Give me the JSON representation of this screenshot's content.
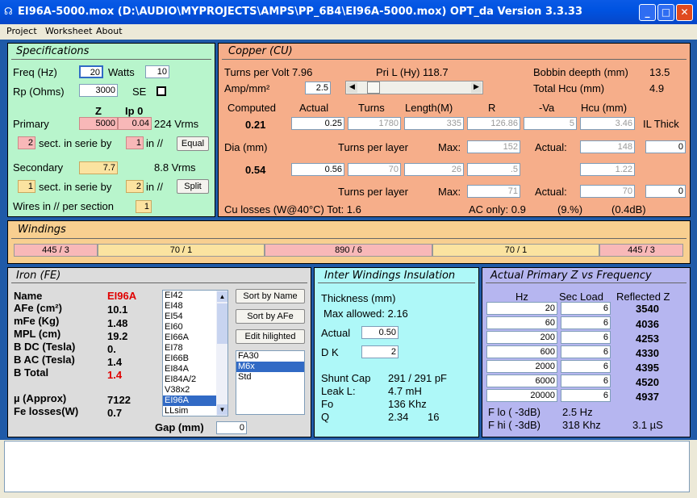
{
  "window": {
    "title": "EI96A-5000.mox  (D:\\AUDIO\\MYPROJECTS\\AMPS\\PP_6B4\\EI96A-5000.mox)  OPT_da Version 3.3.33"
  },
  "menu": [
    "Project",
    "Worksheet",
    "About"
  ],
  "specs": {
    "title": "Specifications",
    "freq_label": "Freq (Hz)",
    "freq": "20",
    "watts_label": "Watts",
    "watts": "10",
    "rp_label": "Rp (Ohms)",
    "rp": "3000",
    "se_label": "SE",
    "z_head": "Z",
    "ip0_head": "Ip 0",
    "primary_label": "Primary",
    "primary_z": "5000",
    "primary_ip0": "0.04",
    "primary_vrms": "224 Vrms",
    "primary_sect": "2",
    "sect_text": "sect. in serie by",
    "primary_par": "1",
    "in_par": "in //",
    "equal_btn": "Equal",
    "secondary_label": "Secondary",
    "secondary_z": "7.7",
    "secondary_vrms": "8.8 Vrms",
    "secondary_sect": "1",
    "secondary_par": "2",
    "split_btn": "Split",
    "wires_label": "Wires in // per section",
    "wires": "1"
  },
  "copper": {
    "title": "Copper (CU)",
    "tpv": "Turns per Volt 7.96",
    "pril": "Pri L (Hy) 118.7",
    "bobbin_label": "Bobbin deepth (mm)",
    "bobbin": "13.5",
    "amp_label": "Amp/mm²",
    "amp": "2.5",
    "hcu_label": "Total Hcu (mm)",
    "hcu": "4.9",
    "h_computed": "Computed",
    "h_actual": "Actual",
    "h_turns": "Turns",
    "h_length": "Length(M)",
    "h_r": "R",
    "h_va": "-Va",
    "h_hcu": "Hcu (mm)",
    "h_il": "IL Thick",
    "computed": "0.21",
    "actual": "0.25",
    "turns": "1780",
    "length": "335",
    "r": "126.86",
    "va": "5",
    "hcu_val": "3.46",
    "dia_label": "Dia (mm)",
    "tpl_label": "Turns per layer",
    "max_label": "Max:",
    "act_label": "Actual:",
    "pri_max": "152",
    "pri_actual": "148",
    "pri_il": "0",
    "dia_computed": "0.54",
    "dia_actual": "0.56",
    "sec_turns": "70",
    "sec_length": "26",
    "sec_r": ".5",
    "sec_hcu": "1.22",
    "sec_max": "71",
    "sec_actual": "70",
    "sec_il": "0",
    "culosses": "Cu losses (W@40°C) Tot: 1.6",
    "aconly": "AC only: 0.9",
    "pct": "(9.%)",
    "db": "(0.4dB)"
  },
  "windings": {
    "title": "Windings",
    "cells": [
      "445 / 3",
      "70 / 1",
      "890 / 6",
      "70 / 1",
      "445 / 3"
    ]
  },
  "iron": {
    "title": "Iron (FE)",
    "name_label": "Name",
    "name": "EI96A",
    "afe_label": "AFe (cm²)",
    "afe": "10.1",
    "mfe_label": "mFe (Kg)",
    "mfe": "1.48",
    "mpl_label": "MPL (cm)",
    "mpl": "19.2",
    "bdc_label": "B DC (Tesla)",
    "bdc": "0.",
    "bac_label": "B AC (Tesla)",
    "bac": "1.4",
    "btot_label": "B Total",
    "btot": "1.4",
    "mu_label": "µ (Approx)",
    "mu": "7122",
    "fel_label": "Fe losses(W)",
    "fel": "0.7",
    "gap_label": "Gap (mm)",
    "gap": "0",
    "cores": [
      "EI42",
      "EI48",
      "EI54",
      "EI60",
      "EI66A",
      "EI78",
      "EI66B",
      "EI84A",
      "EI84A/2",
      "V38x2",
      "EI96A",
      "LLsim"
    ],
    "sort_name_btn": "Sort by Name",
    "sort_afe_btn": "Sort by AFe",
    "edit_btn": "Edit hilighted",
    "materials": [
      "FA30",
      "M6x",
      "Std"
    ]
  },
  "insulation": {
    "title": "Inter Windings Insulation",
    "thick_label": "Thickness (mm)",
    "max_allowed": "Max allowed: 2.16",
    "actual_label": "Actual",
    "actual": "0.50",
    "dk_label": "D K",
    "dk": "2",
    "shunt_label": "Shunt Cap",
    "shunt": "291 / 291 pF",
    "leak_label": "Leak L:",
    "leak": "4.7 mH",
    "fo_label": "Fo",
    "fo": "136 Khz",
    "q_label": "Q",
    "q1": "2.34",
    "q2": "16"
  },
  "freqresp": {
    "title": "Actual Primary Z vs Frequency",
    "h_hz": "Hz",
    "h_load": "Sec Load",
    "h_z": "Reflected Z",
    "rows": [
      {
        "hz": "20",
        "load": "6",
        "z": "3540"
      },
      {
        "hz": "60",
        "load": "6",
        "z": "4036"
      },
      {
        "hz": "200",
        "load": "6",
        "z": "4253"
      },
      {
        "hz": "600",
        "load": "6",
        "z": "4330"
      },
      {
        "hz": "2000",
        "load": "6",
        "z": "4395"
      },
      {
        "hz": "6000",
        "load": "6",
        "z": "4520"
      },
      {
        "hz": "20000",
        "load": "6",
        "z": "4937"
      }
    ],
    "flo_label": "F lo ( -3dB)",
    "flo": "2.5 Hz",
    "fhi_label": "F hi ( -3dB)",
    "fhi": "318 Khz",
    "rise": "3.1 µS"
  }
}
